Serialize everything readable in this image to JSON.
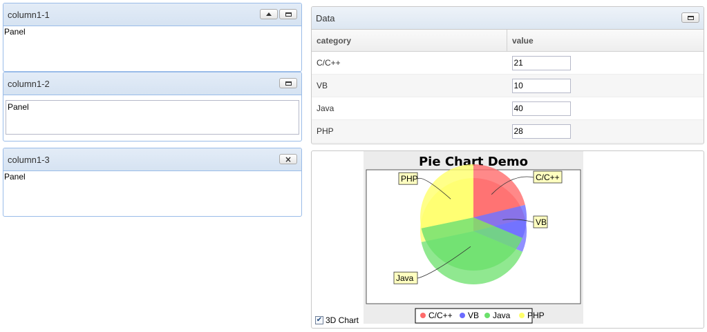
{
  "portal": {
    "column1": [
      {
        "title": "column1-1",
        "body": "Panel"
      },
      {
        "title": "column1-2",
        "body": "Panel"
      },
      {
        "title": "column1-3",
        "body": "Panel"
      }
    ]
  },
  "grid": {
    "title": "Data",
    "columns": [
      "category",
      "value"
    ],
    "rows": [
      {
        "category": "C/C++",
        "value": "21"
      },
      {
        "category": "VB",
        "value": "10"
      },
      {
        "category": "Java",
        "value": "40"
      },
      {
        "category": "PHP",
        "value": "28"
      }
    ]
  },
  "chart_data": {
    "type": "pie",
    "title": "Pie Chart Demo",
    "three_d": true,
    "categories": [
      "C/C++",
      "VB",
      "Java",
      "PHP"
    ],
    "values": [
      21,
      10,
      40,
      28
    ],
    "colors": [
      "#ff6b6b",
      "#6b6bff",
      "#6be06b",
      "#ffff6b"
    ],
    "legend": "bottom",
    "labels": [
      "C/C++",
      "VB",
      "Java",
      "PHP"
    ]
  },
  "options": {
    "three_d_label": "3D Chart",
    "three_d_checked": true
  }
}
